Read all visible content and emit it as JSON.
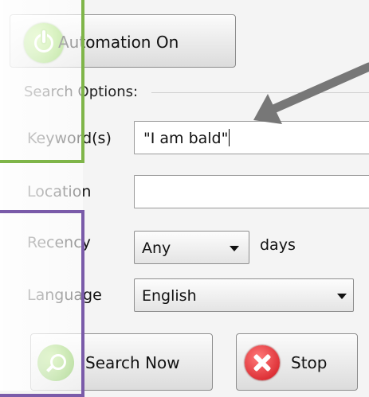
{
  "buttons": {
    "automation": "Automation On",
    "search": "Search Now",
    "stop": "Stop"
  },
  "search_options": {
    "title": "Search Options:",
    "keywords_label": "Keyword(s)",
    "keywords_value": "\"I am bald\"",
    "location_label": "Location",
    "location_value": "",
    "recency_label": "Recency",
    "recency_value": "Any",
    "recency_unit": "days",
    "language_label": "Language",
    "language_value": "English"
  },
  "icons": {
    "automation": "power-icon",
    "search": "magnifier-icon",
    "stop": "stop-x-icon",
    "dropdown": "chevron-down-icon",
    "annotation_arrow": "annotation-arrow-icon"
  },
  "colors": {
    "highlight_green": "#7fb549",
    "highlight_purple": "#7a5ba9",
    "annotation_arrow": "#777777",
    "stop_red": "#d0141c",
    "power_green": "#5ebc1c"
  }
}
